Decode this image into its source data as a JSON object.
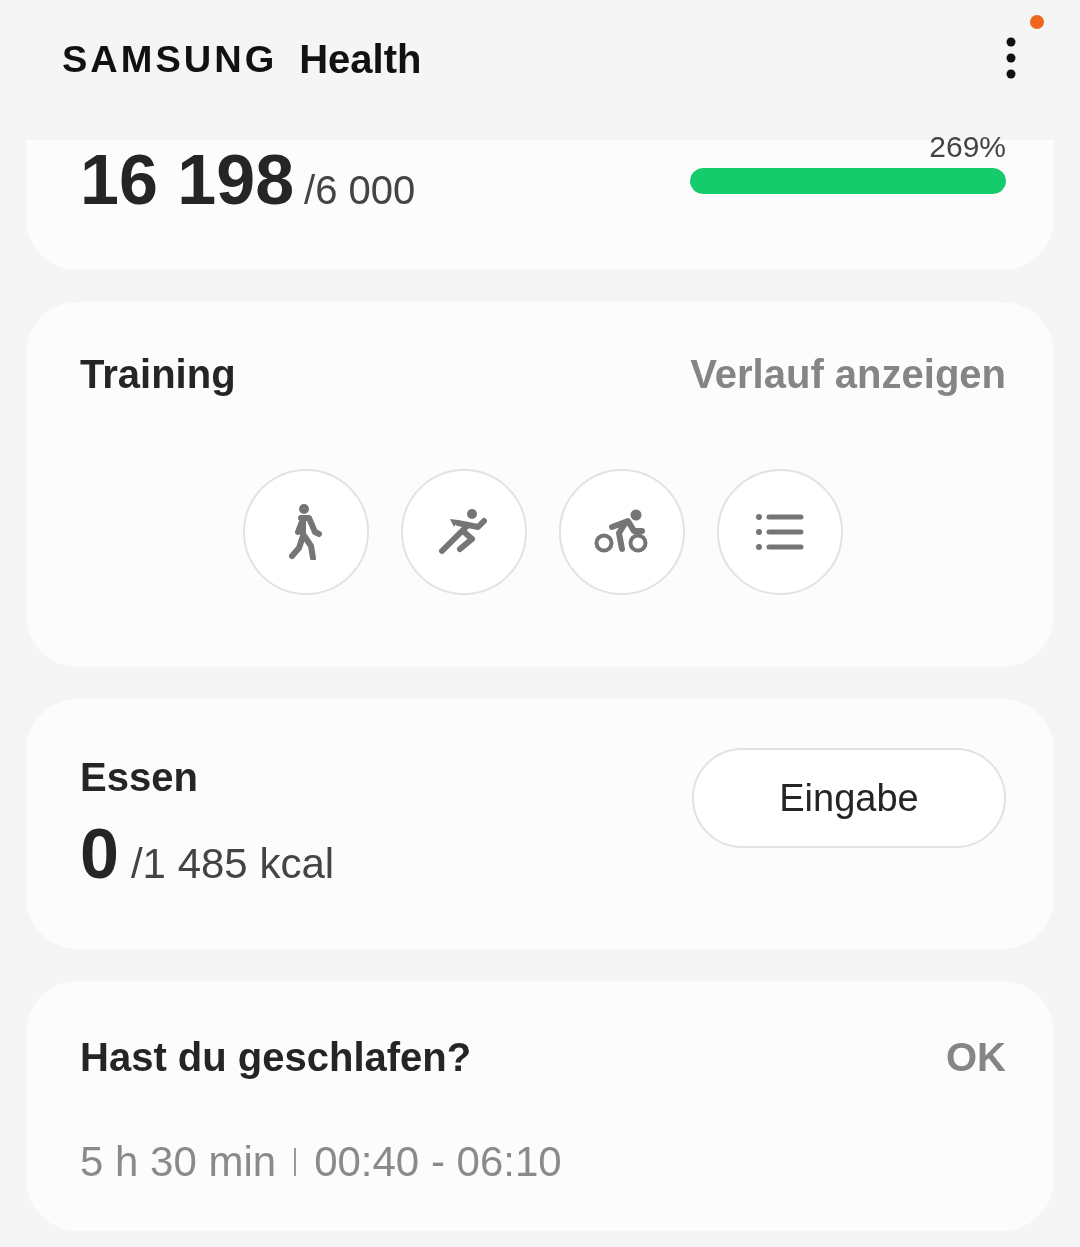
{
  "header": {
    "brand": "SAMSUNG",
    "title": "Health",
    "menu_notification": true
  },
  "steps": {
    "count": "16 198",
    "goal": "/6 000",
    "percent": "269%",
    "level": 1
  },
  "training": {
    "title": "Training",
    "link": "Verlauf anzeigen",
    "activities": [
      {
        "kind": "walk"
      },
      {
        "kind": "run"
      },
      {
        "kind": "bike"
      },
      {
        "kind": "list"
      }
    ]
  },
  "food": {
    "title": "Essen",
    "value": "0",
    "goal": "/1 485 kcal",
    "button": "Eingabe"
  },
  "sleep": {
    "title": "Hast du geschlafen?",
    "action": "OK",
    "duration": "5 h 30 min",
    "range": "00:40 - 06:10"
  }
}
